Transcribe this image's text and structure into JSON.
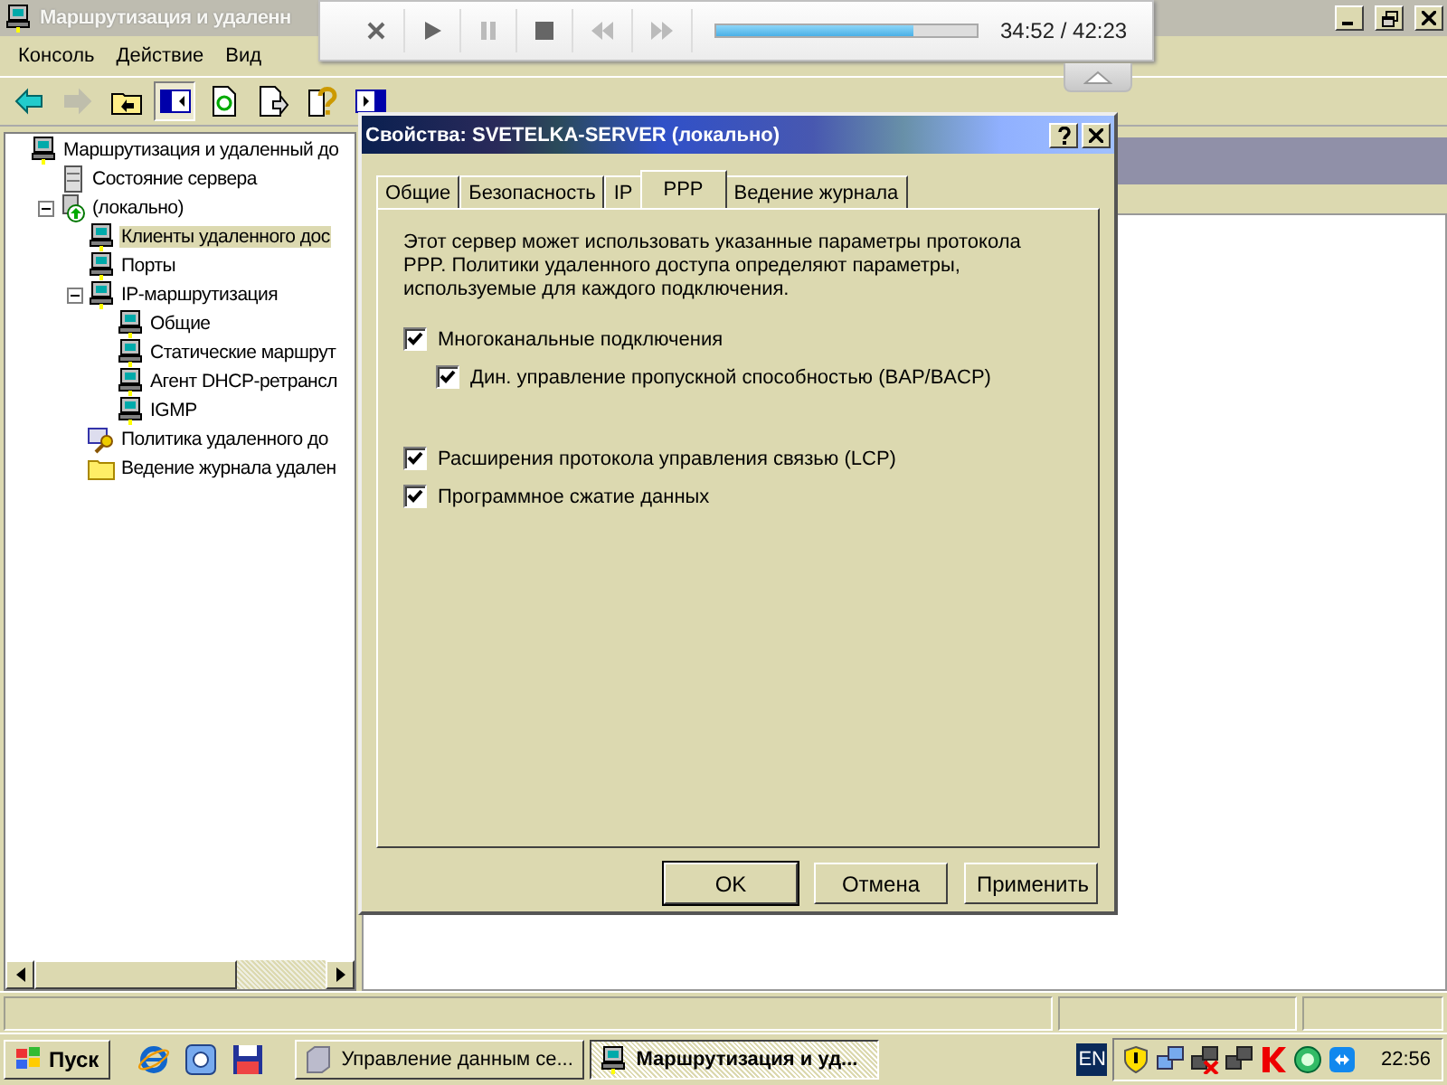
{
  "main_window": {
    "title": "Маршрутизация и удаленн",
    "menu": [
      "Консоль",
      "Действие",
      "Вид"
    ]
  },
  "toolbar": [
    {
      "kind": "back",
      "disabled": false,
      "pressed": false
    },
    {
      "kind": "forward",
      "disabled": true,
      "pressed": false
    },
    {
      "kind": "up",
      "disabled": false,
      "pressed": false
    },
    {
      "kind": "tree",
      "disabled": false,
      "pressed": true
    },
    {
      "kind": "refresh",
      "disabled": false,
      "pressed": false
    },
    {
      "kind": "export",
      "disabled": false,
      "pressed": false
    },
    {
      "kind": "help",
      "disabled": false,
      "pressed": false
    },
    {
      "kind": "panel",
      "disabled": false,
      "pressed": false
    }
  ],
  "tree": [
    {
      "label": "Маршрутизация и удаленный до",
      "kind": "computer",
      "selected": false,
      "children": [
        {
          "label": "Состояние сервера",
          "kind": "server",
          "selected": false
        },
        {
          "label": "(локально)",
          "kind": "server-up",
          "expanded": true,
          "selected": false,
          "children": [
            {
              "label": "Клиенты удаленного дос",
              "kind": "computer",
              "selected": true
            },
            {
              "label": "Порты",
              "kind": "computer",
              "selected": false
            },
            {
              "label": "IP-маршрутизация",
              "kind": "computer",
              "expanded": true,
              "selected": false,
              "children": [
                {
                  "label": "Общие",
                  "kind": "computer",
                  "selected": false
                },
                {
                  "label": "Статические маршрут",
                  "kind": "computer",
                  "selected": false
                },
                {
                  "label": "Агент DHCP-ретрансл",
                  "kind": "computer",
                  "selected": false
                },
                {
                  "label": "IGMP",
                  "kind": "computer",
                  "selected": false
                }
              ]
            },
            {
              "label": "Политика удаленного до",
              "kind": "policy",
              "selected": false
            },
            {
              "label": "Ведение журнала удален",
              "kind": "folder",
              "selected": false
            }
          ]
        }
      ]
    }
  ],
  "dialog": {
    "title": "Свойства: SVETELKA-SERVER (локально)",
    "tabs": [
      {
        "label": "Общие",
        "selected": false
      },
      {
        "label": "Безопасность",
        "selected": false
      },
      {
        "label": "IP",
        "selected": false
      },
      {
        "label": "PPP",
        "selected": true
      },
      {
        "label": "Ведение журнала",
        "selected": false
      }
    ],
    "description": "Этот сервер может использовать указанные параметры протокола PPP. Политики удаленного доступа определяют параметры, используемые для каждого подключения.",
    "options": [
      {
        "label": "Многоканальные подключения",
        "checked": true,
        "children": [
          {
            "label": "Дин. управление пропускной способностью (BAP/BACP)",
            "checked": true
          }
        ]
      },
      {
        "label": "Расширения протокола управления связью (LCP)",
        "checked": true
      },
      {
        "label": "Программное сжатие данных",
        "checked": true
      }
    ],
    "buttons": [
      {
        "label": "OK",
        "default": true
      },
      {
        "label": "Отмена",
        "default": false
      },
      {
        "label": "Применить",
        "default": false
      }
    ]
  },
  "media_player": {
    "level": 0.76,
    "time": "34:52 / 42:23"
  },
  "taskbar": {
    "start": "Пуск",
    "tasks": [
      {
        "label": "Управление данным се...",
        "selected": false
      },
      {
        "label": "Маршрутизация и уд...",
        "selected": true
      }
    ],
    "language": "EN",
    "clock": "22:56"
  }
}
